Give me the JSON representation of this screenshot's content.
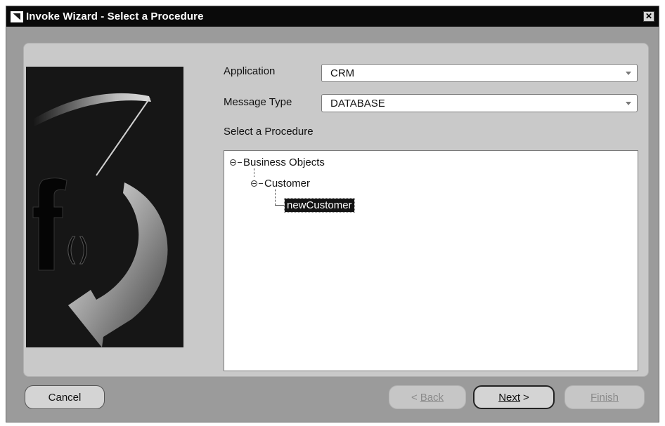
{
  "window": {
    "title": "Invoke Wizard - Select a Procedure",
    "close_glyph": "✕"
  },
  "form": {
    "application_label": "Application",
    "application_value": "CRM",
    "message_type_label": "Message Type",
    "message_type_value": "DATABASE",
    "procedure_label": "Select a Procedure"
  },
  "tree": {
    "root": "Business Objects",
    "child": "Customer",
    "leaf": "newCustomer"
  },
  "buttons": {
    "cancel": "Cancel",
    "back": "Back",
    "next": "Next",
    "finish": "Finish"
  },
  "icons": {
    "wizard_graphic": "function-f-with-arrow-graphic",
    "dropdown": "chevron-down-icon",
    "tree_toggle": "collapse-circle-icon"
  },
  "colors": {
    "title_bar": "#0a0a0a",
    "selection": "#141414"
  }
}
